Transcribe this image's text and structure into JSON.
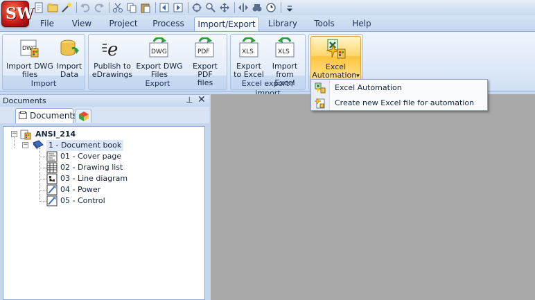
{
  "app": {
    "logo_text": "SW"
  },
  "menu_tabs": [
    "File",
    "View",
    "Project",
    "Process",
    "Import/Export",
    "Library",
    "Tools",
    "Help"
  ],
  "active_tab": "Import/Export",
  "ribbon": {
    "groups": [
      {
        "label": "Import",
        "buttons": [
          {
            "line1": "Import DWG",
            "line2": "files"
          },
          {
            "line1": "Import",
            "line2": "Data"
          }
        ]
      },
      {
        "label": "Export",
        "buttons": [
          {
            "line1": "Publish to",
            "line2": "eDrawings"
          },
          {
            "line1": "Export DWG",
            "line2": "Files"
          },
          {
            "line1": "Export PDF",
            "line2": "files"
          }
        ]
      },
      {
        "label": "Excel export / import",
        "buttons": [
          {
            "line1": "Export",
            "line2": "to Excel"
          },
          {
            "line1": "Import",
            "line2": "from Excel"
          }
        ]
      },
      {
        "label": "",
        "buttons": [
          {
            "line1": "Excel",
            "line2": "Automation",
            "arrow": "▾"
          }
        ]
      }
    ],
    "icon_texts": {
      "dwg": "DWG",
      "pdf": "PDF",
      "xls": "XLS",
      "edrawings": "e"
    }
  },
  "documents_panel": {
    "title": "Documents",
    "pin_glyph": "⊥",
    "close_glyph": "✕",
    "tab_label": "Documents",
    "tree": {
      "project": "ANSI_214",
      "book": "1 - Document book",
      "items": [
        "01 - Cover page",
        "02 - Drawing list",
        "03 - Line diagram",
        "04 - Power",
        "05 - Control"
      ]
    }
  },
  "dropdown": {
    "items": [
      "Excel Automation",
      "Create new Excel file for automation"
    ]
  },
  "colors": {
    "workspace": "#a9a9a9",
    "ribbon_highlight": "#ffd56b",
    "logo_red": "#c4161a"
  }
}
